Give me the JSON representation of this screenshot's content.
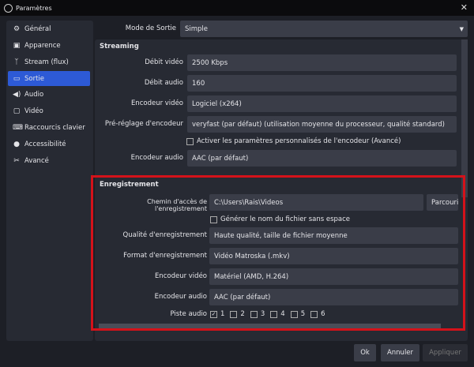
{
  "window": {
    "title": "Paramètres",
    "close_icon": "close-icon"
  },
  "sidebar": {
    "items": [
      {
        "label": "Général",
        "icon": "gear-icon"
      },
      {
        "label": "Apparence",
        "icon": "appearance-icon"
      },
      {
        "label": "Stream (flux)",
        "icon": "antenna-icon"
      },
      {
        "label": "Sortie",
        "icon": "output-icon",
        "selected": true
      },
      {
        "label": "Audio",
        "icon": "speaker-icon"
      },
      {
        "label": "Vidéo",
        "icon": "monitor-icon"
      },
      {
        "label": "Raccourcis clavier",
        "icon": "keyboard-icon"
      },
      {
        "label": "Accessibilité",
        "icon": "accessibility-icon"
      },
      {
        "label": "Avancé",
        "icon": "tools-icon"
      }
    ]
  },
  "mode": {
    "label": "Mode de Sortie",
    "value": "Simple"
  },
  "streaming": {
    "heading": "Streaming",
    "video_bitrate": {
      "label": "Débit vidéo",
      "value": "2500 Kbps"
    },
    "audio_bitrate": {
      "label": "Débit audio",
      "value": "160"
    },
    "video_encoder": {
      "label": "Encodeur vidéo",
      "value": "Logiciel (x264)"
    },
    "preset": {
      "label": "Pré-réglage d'encodeur",
      "value": "veryfast (par défaut) (utilisation moyenne du processeur, qualité standard)"
    },
    "custom_settings": {
      "label": "Activer les paramètres personnalisés de l'encodeur (Avancé)",
      "checked": false
    },
    "audio_encoder": {
      "label": "Encodeur audio",
      "value": "AAC (par défaut)"
    }
  },
  "recording": {
    "heading": "Enregistrement",
    "path": {
      "label": "Chemin d'accès de l'enregistrement",
      "value": "C:\\Users\\Rais\\Videos",
      "browse": "Parcourir"
    },
    "no_space": {
      "label": "Générer le nom du fichier sans espace",
      "checked": false
    },
    "quality": {
      "label": "Qualité d'enregistrement",
      "value": "Haute qualité, taille de fichier moyenne"
    },
    "format": {
      "label": "Format d'enregistrement",
      "value": "Vidéo Matroska (.mkv)"
    },
    "video_encoder": {
      "label": "Encodeur vidéo",
      "value": "Matériel (AMD, H.264)"
    },
    "audio_encoder": {
      "label": "Encodeur audio",
      "value": "AAC (par défaut)"
    },
    "tracks": {
      "label": "Piste audio",
      "items": [
        {
          "n": "1",
          "checked": true
        },
        {
          "n": "2",
          "checked": false
        },
        {
          "n": "3",
          "checked": false
        },
        {
          "n": "4",
          "checked": false
        },
        {
          "n": "5",
          "checked": false
        },
        {
          "n": "6",
          "checked": false
        }
      ]
    }
  },
  "highlight_color": "#d4121a",
  "buttons": {
    "ok": "Ok",
    "cancel": "Annuler",
    "apply": "Appliquer"
  }
}
